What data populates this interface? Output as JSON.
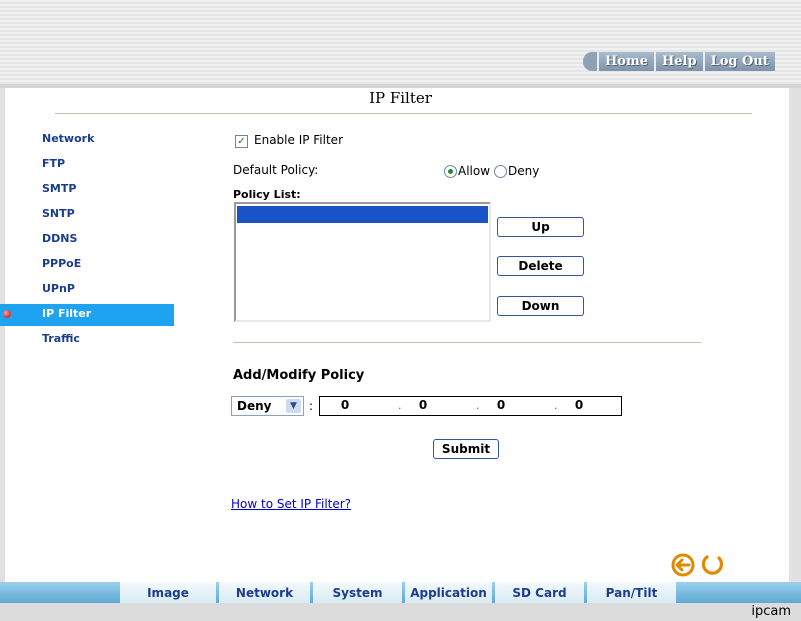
{
  "top_nav": {
    "home": "Home",
    "help": "Help",
    "logout": "Log Out"
  },
  "page_title": "IP Filter",
  "sidebar": {
    "items": [
      {
        "label": "Network"
      },
      {
        "label": "FTP"
      },
      {
        "label": "SMTP"
      },
      {
        "label": "SNTP"
      },
      {
        "label": "DDNS"
      },
      {
        "label": "PPPoE"
      },
      {
        "label": "UPnP"
      },
      {
        "label": "IP Filter"
      },
      {
        "label": "Traffic"
      }
    ],
    "active": "IP Filter"
  },
  "enable": {
    "label": "Enable IP Filter",
    "checked": true
  },
  "default_policy": {
    "label": "Default Policy:",
    "allow": "Allow",
    "deny": "Deny",
    "selected": "Allow"
  },
  "policy_list": {
    "label": "Policy List:",
    "items": []
  },
  "buttons": {
    "up": "Up",
    "delete": "Delete",
    "down": "Down",
    "submit": "Submit"
  },
  "add_modify": {
    "heading": "Add/Modify Policy",
    "action": "Deny",
    "ip": [
      "0",
      "0",
      "0",
      "0"
    ]
  },
  "help_link": "How to Set IP Filter?",
  "bottom_tabs": [
    "Image",
    "Network",
    "System",
    "Application",
    "SD Card",
    "Pan/Tilt"
  ],
  "footer": "ipcam",
  "icons": {
    "back": "back-arrow-icon",
    "refresh": "refresh-icon"
  },
  "colors": {
    "active_menu": "#1fa2f0",
    "menu_text": "#1a3d8f",
    "tab_bar": "#5ea9d6"
  }
}
